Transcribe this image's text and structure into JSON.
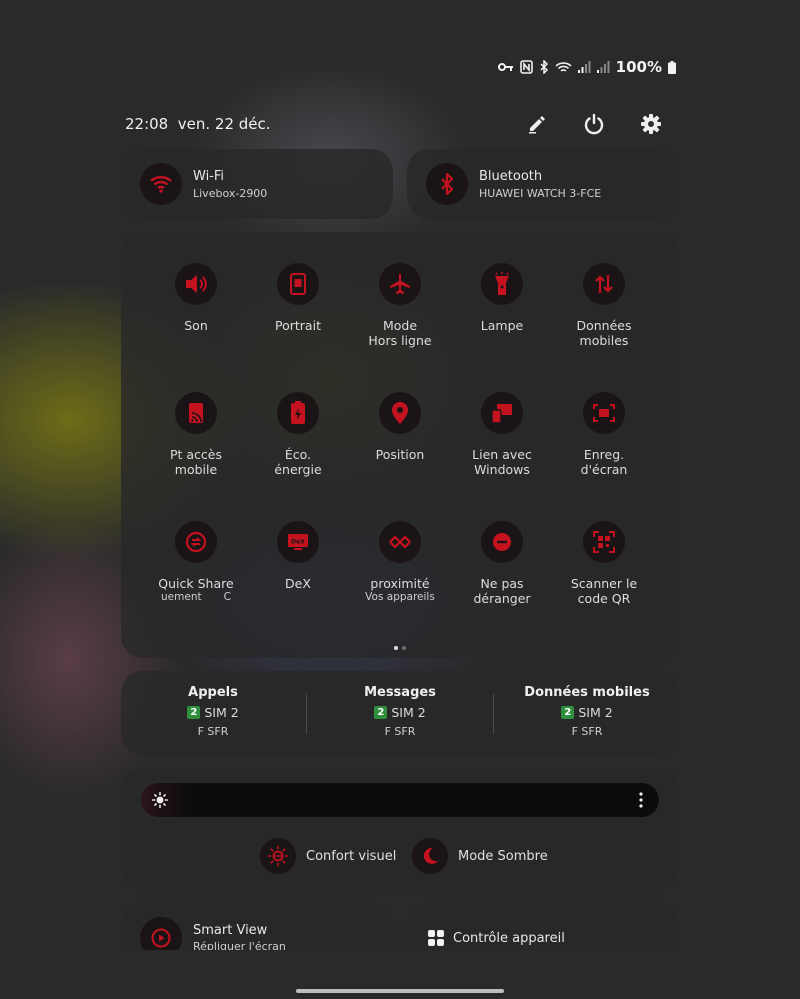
{
  "status_bar": {
    "battery_percent": "100%"
  },
  "header": {
    "time": "22:08",
    "date": "ven. 22 déc."
  },
  "connections": [
    {
      "title": "Wi-Fi",
      "subtitle": "Livebox-2900"
    },
    {
      "title": "Bluetooth",
      "subtitle": "HUAWEI WATCH 3-FCE"
    }
  ],
  "tiles": [
    {
      "label": "Son",
      "icon": "speaker-icon"
    },
    {
      "label": "Portrait",
      "icon": "portrait-icon"
    },
    {
      "label": "Mode\nHors ligne",
      "icon": "airplane-icon"
    },
    {
      "label": "Lampe",
      "icon": "flashlight-icon"
    },
    {
      "label": "Données\nmobiles",
      "icon": "mobile-data-icon"
    },
    {
      "label": "Pt accès\nmobile",
      "icon": "hotspot-icon"
    },
    {
      "label": "Éco.\nénergie",
      "icon": "battery-saver-icon"
    },
    {
      "label": "Position",
      "icon": "location-pin-icon"
    },
    {
      "label": "Lien avec\nWindows",
      "icon": "link-windows-icon"
    },
    {
      "label": "Enreg.\nd'écran",
      "icon": "screen-record-icon"
    },
    {
      "label": "Quick Share",
      "sub": "uement",
      "sub2": "C",
      "icon": "quick-share-icon"
    },
    {
      "label": "DeX",
      "icon": "dex-icon"
    },
    {
      "label": "proximité",
      "sub": "Vos appareils",
      "icon": "nearby-share-icon"
    },
    {
      "label": "Ne pas\ndéranger",
      "icon": "do-not-disturb-icon"
    },
    {
      "label": "Scanner le\ncode QR",
      "icon": "qr-scan-icon"
    }
  ],
  "sim": [
    {
      "title": "Appels",
      "sim_num": "2",
      "sim_label": "SIM 2",
      "carrier": "F SFR"
    },
    {
      "title": "Messages",
      "sim_num": "2",
      "sim_label": "SIM 2",
      "carrier": "F SFR"
    },
    {
      "title": "Données mobiles",
      "sim_num": "2",
      "sim_label": "SIM 2",
      "carrier": "F SFR"
    }
  ],
  "display": {
    "comfort_label": "Confort visuel",
    "dark_label": "Mode Sombre"
  },
  "bottom": [
    {
      "title": "Smart View",
      "subtitle": "Répliquer l'écran"
    },
    {
      "title": "Contrôle appareil"
    }
  ],
  "colors": {
    "accent": "#c4121f",
    "icon_bg": "#1b1416",
    "panel": "#2a2a2c",
    "sim_badge": "#2f8f3c"
  }
}
